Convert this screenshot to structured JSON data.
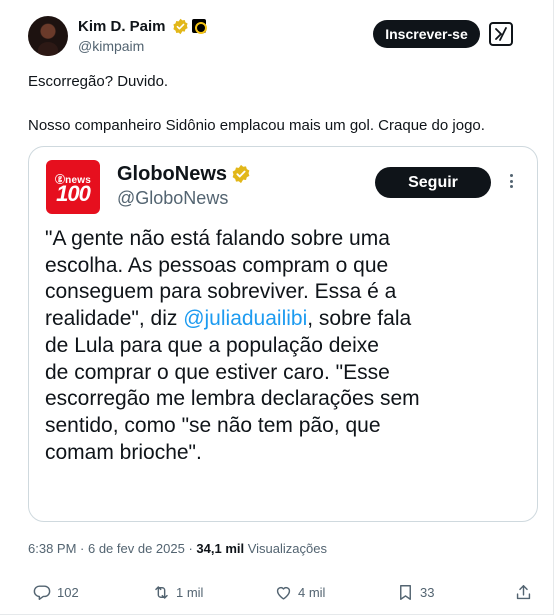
{
  "author": {
    "name": "Kim D. Paim",
    "handle": "@kimpaim"
  },
  "header": {
    "subscribe_label": "Inscrever-se"
  },
  "tweet": {
    "line1": "Escorregão? Duvido.",
    "line2": "Nosso companheiro Sidônio emplacou mais um gol. Craque do jogo."
  },
  "quoted": {
    "logo_top": "ⓖnews",
    "logo_num": "100",
    "name": "GloboNews",
    "handle": "@GloboNews",
    "follow_label": "Seguir",
    "lines": [
      "\"A gente não está falando sobre uma",
      "escolha. As pessoas compram o que",
      "conseguem para sobreviver. Essa é a",
      [
        "realidade\", diz ",
        "@juliaduailibi",
        ", sobre fala"
      ],
      "de Lula para que a população deixe",
      "de comprar o que estiver caro. \"Esse",
      "escorregão me lembra declarações sem",
      "sentido, como \"se não tem pão, que",
      "comam brioche\"."
    ]
  },
  "meta": {
    "time": "6:38 PM",
    "date": "6 de fev de 2025",
    "sep": " · ",
    "views_count": "34,1 mil",
    "views_label": " Visualizações"
  },
  "actions": {
    "replies": "102",
    "retweets": "1 mil",
    "likes": "4 mil",
    "bookmarks": "33"
  },
  "colors": {
    "accent": "#1d9bf0",
    "verified_gold": "#e2b719",
    "brand_red": "#e60f1e"
  },
  "icons": {
    "verified": "verified-gold-badge-icon",
    "affiliate": "affiliate-badge-icon",
    "grok": "grok-icon",
    "more": "more-options-icon",
    "reply": "reply-icon",
    "retweet": "retweet-icon",
    "like": "heart-icon",
    "bookmark": "bookmark-icon",
    "share": "share-icon"
  }
}
